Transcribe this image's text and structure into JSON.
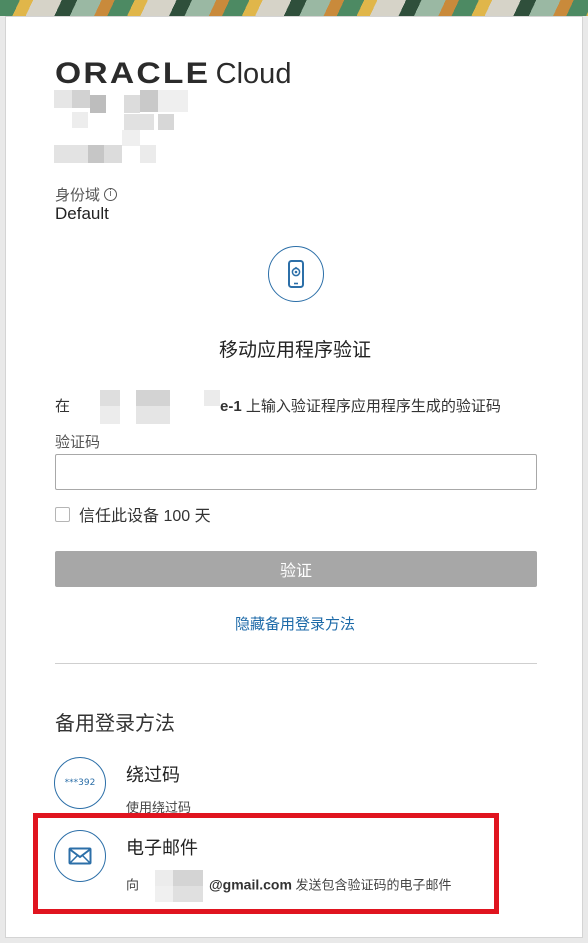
{
  "header": {
    "logo_brand": "ORACLE",
    "logo_product": "Cloud"
  },
  "identity_domain": {
    "label": "身份域",
    "info_icon": "info-icon",
    "value": "Default"
  },
  "method": {
    "icon": "mobile-app-icon",
    "title": "移动应用程序验证",
    "description_prefix": "在",
    "description_bold": "e-1",
    "description_suffix": " 上输入验证程序应用程序生成的验证码"
  },
  "form": {
    "code_label": "验证码",
    "code_value": "",
    "trust_label": "信任此设备 100 天",
    "trust_checked": false,
    "verify_button": "验证",
    "hide_alternates_link": "隐藏备用登录方法"
  },
  "alternates": {
    "heading": "备用登录方法",
    "items": [
      {
        "icon": "bypass-code-icon",
        "icon_text": "***392",
        "title": "绕过码",
        "subtitle": "使用绕过码"
      },
      {
        "icon": "envelope-icon",
        "title": "电子邮件",
        "subtitle_prefix": "向",
        "subtitle_bold": "@gmail.com",
        "subtitle_suffix": " 发送包含验证码的电子邮件"
      }
    ]
  },
  "colors": {
    "accent": "#2c6fa8",
    "link": "#1d6aa8",
    "button_disabled": "#a7a7a7",
    "highlight_border": "#e0141f"
  }
}
